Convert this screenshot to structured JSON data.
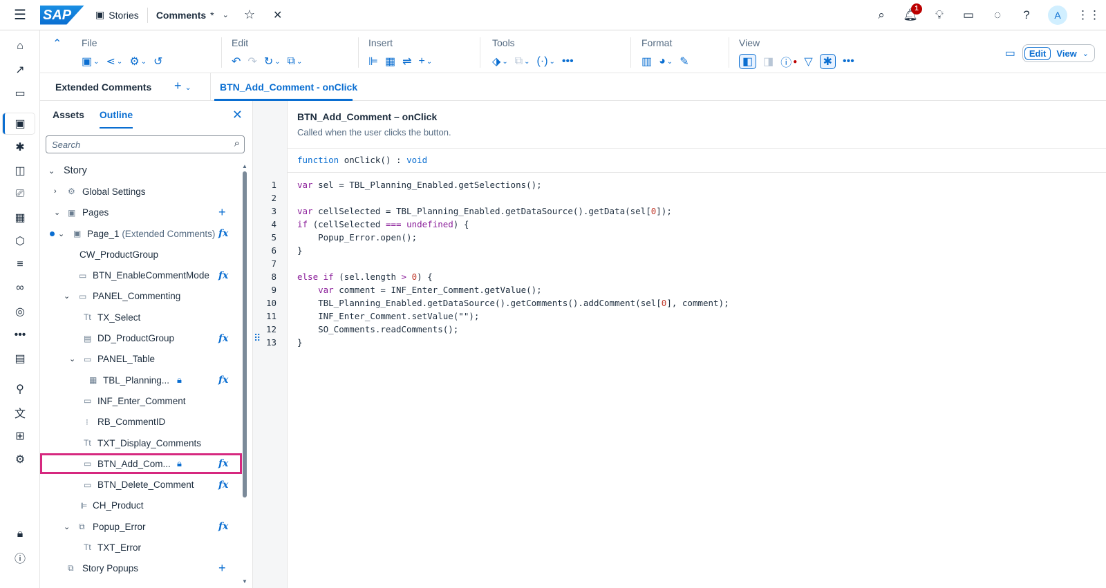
{
  "shell": {
    "logo": "SAP",
    "breadcrumb": "Stories",
    "title": "Comments",
    "title_modified": "*",
    "notification_count": "1",
    "avatar": "A"
  },
  "toolbar": {
    "groups": [
      "File",
      "Edit",
      "Insert",
      "Tools",
      "Format",
      "View"
    ],
    "edit_label": "Edit",
    "view_label": "View"
  },
  "tabs": {
    "extended": "Extended Comments",
    "code": "BTN_Add_Comment - onClick"
  },
  "panel": {
    "tab_assets": "Assets",
    "tab_outline": "Outline",
    "search_placeholder": "Search",
    "tree": [
      {
        "label": "Story"
      },
      {
        "label": "Global Settings"
      },
      {
        "label": "Pages"
      },
      {
        "label": "Page_1",
        "sub": "(Extended Comments)"
      },
      {
        "label": "CW_ProductGroup"
      },
      {
        "label": "BTN_EnableCommentMode"
      },
      {
        "label": "PANEL_Commenting"
      },
      {
        "label": "TX_Select"
      },
      {
        "label": "DD_ProductGroup"
      },
      {
        "label": "PANEL_Table"
      },
      {
        "label": "TBL_Planning..."
      },
      {
        "label": "INF_Enter_Comment"
      },
      {
        "label": "RB_CommentID"
      },
      {
        "label": "TXT_Display_Comments"
      },
      {
        "label": "BTN_Add_Com..."
      },
      {
        "label": "BTN_Delete_Comment"
      },
      {
        "label": "CH_Product"
      },
      {
        "label": "Popup_Error"
      },
      {
        "label": "TXT_Error"
      },
      {
        "label": "Story Popups"
      }
    ]
  },
  "editor": {
    "title": "BTN_Add_Comment – onClick",
    "description": "Called when the user clicks the button.",
    "signature": {
      "kw1": "function",
      "name": " onClick() : ",
      "kw2": "void"
    },
    "line_numbers": [
      "1",
      "2",
      "3",
      "4",
      "5",
      "6",
      "7",
      "8",
      "9",
      "10",
      "11",
      "12",
      "13"
    ]
  },
  "colors": {
    "accent": "#0a6ed1",
    "selection": "#d6287f",
    "badge": "#bb0000"
  }
}
